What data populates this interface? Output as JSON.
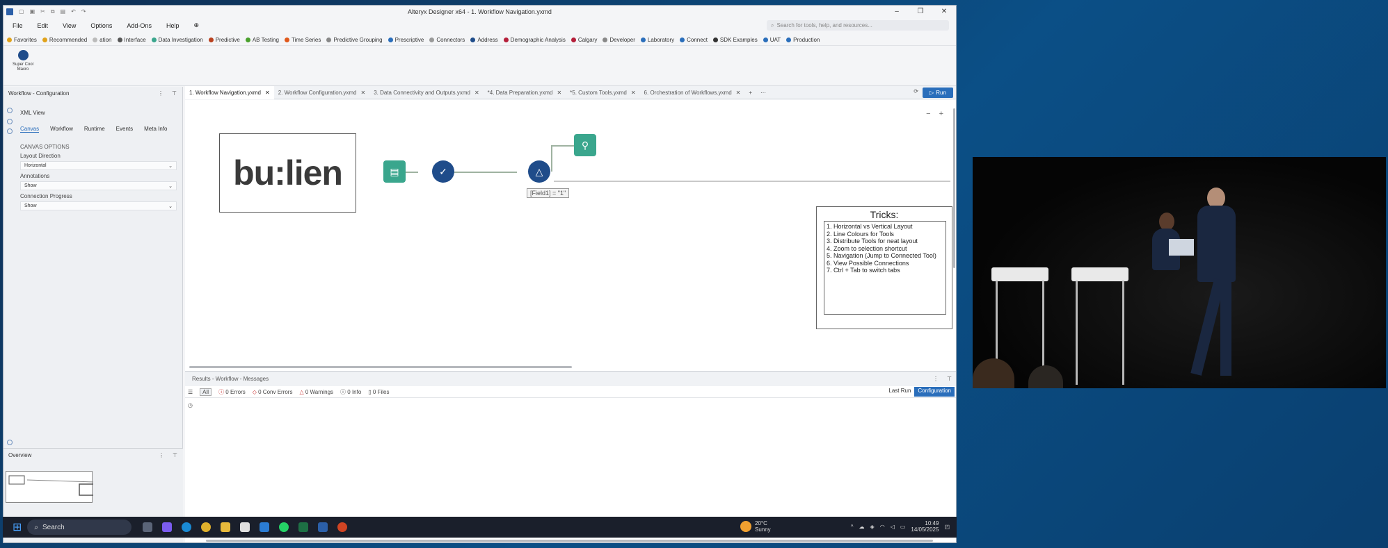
{
  "window": {
    "title": "Alteryx Designer x64 - 1. Workflow Navigation.yxmd"
  },
  "menu": [
    "File",
    "Edit",
    "View",
    "Options",
    "Add-Ons",
    "Help"
  ],
  "search": {
    "placeholder": "Search for tools, help, and resources..."
  },
  "palette": [
    {
      "label": "Favorites",
      "color": "#e0a21b"
    },
    {
      "label": "Recommended",
      "color": "#e0a21b"
    },
    {
      "label": "ation",
      "color": "#bbbbbb"
    },
    {
      "label": "Interface",
      "color": "#555555"
    },
    {
      "label": "Data Investigation",
      "color": "#3aa68d"
    },
    {
      "label": "Predictive",
      "color": "#b9411f"
    },
    {
      "label": "AB Testing",
      "color": "#49a02c"
    },
    {
      "label": "Time Series",
      "color": "#e0581b"
    },
    {
      "label": "Predictive Grouping",
      "color": "#888888"
    },
    {
      "label": "Prescriptive",
      "color": "#2a6ebb"
    },
    {
      "label": "Connectors",
      "color": "#999999"
    },
    {
      "label": "Address",
      "color": "#1f4c8a"
    },
    {
      "label": "Demographic Analysis",
      "color": "#b51f3a"
    },
    {
      "label": "Calgary",
      "color": "#b51f3a"
    },
    {
      "label": "Developer",
      "color": "#888888"
    },
    {
      "label": "Laboratory",
      "color": "#2a6ebb"
    },
    {
      "label": "Connect",
      "color": "#2a6ebb"
    },
    {
      "label": "SDK Examples",
      "color": "#333333"
    },
    {
      "label": "UAT",
      "color": "#2a6ebb"
    },
    {
      "label": "Production",
      "color": "#2a6ebb"
    }
  ],
  "macro": {
    "label": "Super Cool Macro"
  },
  "config_panel": {
    "title": "Workflow - Configuration",
    "xml_view": "XML View",
    "tabs": [
      "Canvas",
      "Workflow",
      "Runtime",
      "Events",
      "Meta Info"
    ],
    "section": "CANVAS OPTIONS",
    "layout_label": "Layout Direction",
    "layout_value": "Horizontal",
    "annotations_label": "Annotations",
    "annotations_value": "Show",
    "progress_label": "Connection Progress",
    "progress_value": "Show"
  },
  "overview": {
    "title": "Overview"
  },
  "tabs": [
    "1. Workflow Navigation.yxmd",
    "2. Workflow Configuration.yxmd",
    "3. Data Connectivity and Outputs.yxmd",
    "*4. Data Preparation.yxmd",
    "*5. Custom Tools.yxmd",
    "6. Orchestration of Workflows.yxmd"
  ],
  "run_label": "Run",
  "canvas": {
    "logo_text": "bu:lien",
    "filter_expr": "[Field1] = \"1\"",
    "tricks_title": "Tricks:",
    "tricks": [
      "1. Horizontal vs Vertical Layout",
      "2. Line Colours for Tools",
      "3. Distribute Tools for neat layout",
      "4. Zoom to selection shortcut",
      "5. Navigation (Jump to Connected Tool)",
      "6. View Possible Connections",
      "7. Ctrl + Tab to switch tabs"
    ]
  },
  "results": {
    "title": "Results - Workflow - Messages",
    "all": "All",
    "errors": "0 Errors",
    "conv_errors": "0 Conv Errors",
    "warnings": "0 Warnings",
    "info": "0 Info",
    "files": "0 Files",
    "last_run": "Last Run",
    "configuration": "Configuration"
  },
  "taskbar": {
    "search": "Search",
    "temp": "20°C",
    "weather": "Sunny",
    "time": "10:49",
    "date": "14/05/2025"
  }
}
